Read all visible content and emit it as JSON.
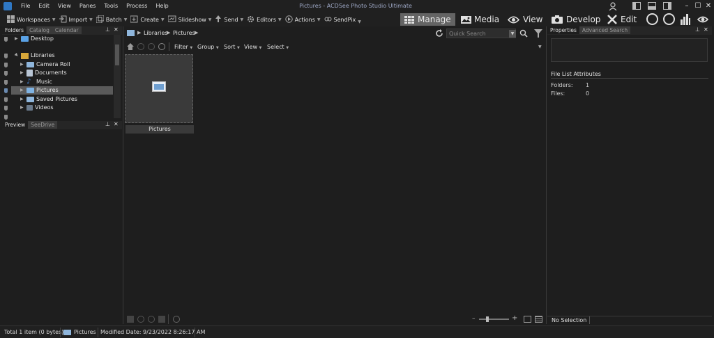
{
  "window": {
    "title": "Pictures - ACDSee Photo Studio Ultimate",
    "minimize": "–",
    "maximize": "☐",
    "close": "✕"
  },
  "menu": [
    "File",
    "Edit",
    "View",
    "Panes",
    "Tools",
    "Process",
    "Help"
  ],
  "toolbar": {
    "items": [
      {
        "label": "Workspaces",
        "icon": "workspaces-icon",
        "caret": true
      },
      {
        "label": "Import",
        "icon": "import-icon",
        "caret": true
      },
      {
        "label": "Batch",
        "icon": "batch-icon",
        "caret": true
      },
      {
        "label": "Create",
        "icon": "create-icon",
        "caret": true
      },
      {
        "label": "Slideshow",
        "icon": "slideshow-icon",
        "caret": true
      },
      {
        "label": "Send",
        "icon": "send-icon",
        "caret": true
      },
      {
        "label": "Editors",
        "icon": "editors-icon",
        "caret": true
      },
      {
        "label": "Actions",
        "icon": "actions-icon",
        "caret": true
      },
      {
        "label": "SendPix",
        "icon": "sendpix-icon",
        "caret": true
      }
    ],
    "modes": [
      "Manage",
      "Media",
      "View",
      "Develop",
      "Edit"
    ],
    "active_mode": "Manage"
  },
  "folders_panel": {
    "tabs": [
      "Folders",
      "Catalog",
      "Calendar"
    ],
    "tree": [
      {
        "label": "Desktop",
        "level": 1,
        "icon": "desktop-folder-icon",
        "expand": "collapsed"
      },
      {
        "label": "Libraries",
        "level": 1,
        "icon": "libraries-icon",
        "expand": "expanded"
      },
      {
        "label": "Camera Roll",
        "level": 2,
        "icon": "camera-roll-icon",
        "expand": "collapsed"
      },
      {
        "label": "Documents",
        "level": 2,
        "icon": "documents-icon",
        "expand": "collapsed"
      },
      {
        "label": "Music",
        "level": 2,
        "icon": "music-icon",
        "expand": "collapsed"
      },
      {
        "label": "Pictures",
        "level": 2,
        "icon": "pictures-icon",
        "expand": "collapsed",
        "selected": true
      },
      {
        "label": "Saved Pictures",
        "level": 2,
        "icon": "saved-pictures-icon",
        "expand": "collapsed"
      },
      {
        "label": "Videos",
        "level": 2,
        "icon": "videos-icon",
        "expand": "collapsed"
      }
    ]
  },
  "preview_panel": {
    "tabs": [
      "Preview",
      "SeeDrive"
    ]
  },
  "file_list": {
    "breadcrumb": [
      "Libraries",
      "Pictures"
    ],
    "search_placeholder": "Quick Search",
    "filter_bar": [
      "Filter",
      "Group",
      "Sort",
      "View",
      "Select"
    ],
    "items": [
      {
        "label": "Pictures",
        "type": "folder"
      }
    ]
  },
  "properties_panel": {
    "tabs": [
      "Properties",
      "Advanced Search"
    ],
    "section_title": "File List Attributes",
    "attributes": [
      {
        "name": "Folders:",
        "value": "1"
      },
      {
        "name": "Files:",
        "value": "0"
      }
    ],
    "footer_tab": "No Selection"
  },
  "status_bar": {
    "total": "Total 1 item  (0 bytes)",
    "location": "Pictures",
    "modified": "Modified Date: 9/23/2022 8:26:17 AM"
  },
  "colors": {
    "selection": "#5a5a5a",
    "accent": "#2f78c4",
    "title_text": "#9ea8c6"
  }
}
